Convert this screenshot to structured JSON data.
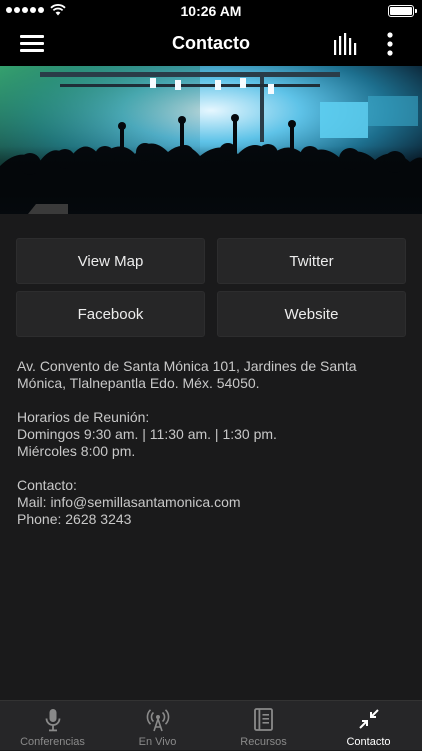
{
  "status_bar": {
    "time": "10:26 AM"
  },
  "nav": {
    "title": "Contacto"
  },
  "buttons": {
    "view_map": "View Map",
    "twitter": "Twitter",
    "facebook": "Facebook",
    "website": "Website"
  },
  "info": {
    "address_line1": "Av. Convento de Santa Mónica 101, Jardines de Santa",
    "address_line2": "Mónica, Tlalnepantla Edo. Méx. 54050.",
    "schedule_title": "Horarios de Reunión:",
    "schedule_sundays": "Domingos 9:30 am. | 11:30 am. | 1:30 pm.",
    "schedule_wednesdays": "Miércoles 8:00 pm.",
    "contact_title": "Contacto:",
    "contact_mail": "Mail: info@semillasantamonica.com",
    "contact_phone": "Phone: 2628 3243"
  },
  "tabs": [
    {
      "label": "Conferencias",
      "icon": "microphone-icon",
      "active": false
    },
    {
      "label": "En Vivo",
      "icon": "antenna-icon",
      "active": false
    },
    {
      "label": "Recursos",
      "icon": "book-icon",
      "active": false
    },
    {
      "label": "Contacto",
      "icon": "collapse-arrows-icon",
      "active": true
    }
  ],
  "colors": {
    "background": "#1a1a1b",
    "bar": "#000000",
    "button": "#262627",
    "tab_bar": "#262628",
    "active_tab": "#ffffff",
    "inactive_tab": "#8a8a8a"
  }
}
